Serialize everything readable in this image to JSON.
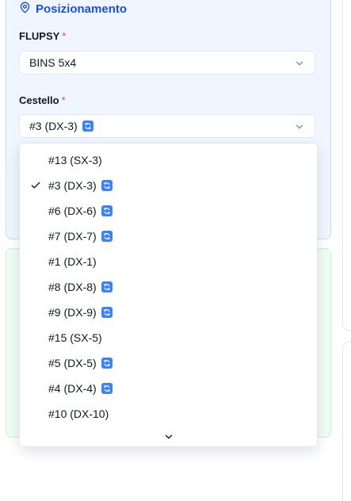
{
  "section": {
    "title": "Posizionamento"
  },
  "flupsy": {
    "label": "FLUPSY",
    "required_mark": "*",
    "value": "BINS 5x4"
  },
  "cestello": {
    "label": "Cestello",
    "required_mark": "*",
    "value": "#3 (DX-3)",
    "value_has_badge": true
  },
  "dropdown": {
    "selected_index": 1,
    "options": [
      {
        "label": "#13 (SX-3)",
        "badge": false
      },
      {
        "label": "#3 (DX-3)",
        "badge": true
      },
      {
        "label": "#6 (DX-6)",
        "badge": true
      },
      {
        "label": "#7 (DX-7)",
        "badge": true
      },
      {
        "label": "#1 (DX-1)",
        "badge": false
      },
      {
        "label": "#8 (DX-8)",
        "badge": true
      },
      {
        "label": "#9 (DX-9)",
        "badge": true
      },
      {
        "label": "#15 (SX-5)",
        "badge": false
      },
      {
        "label": "#5 (DX-5)",
        "badge": true
      },
      {
        "label": "#4 (DX-4)",
        "badge": true
      },
      {
        "label": "#10 (DX-10)",
        "badge": false
      }
    ]
  },
  "icons": {
    "section": "map-pin-icon",
    "select_arrow": "chevron-down-icon",
    "badge": "refresh-icon",
    "selected": "check-icon",
    "scroll": "chevron-down-icon"
  },
  "colors": {
    "accent": "#1d4ed8",
    "required": "#ef4444",
    "badge": "#3b82f6",
    "panel_blue": "#eff6ff",
    "panel_green": "#f0fdf4"
  }
}
